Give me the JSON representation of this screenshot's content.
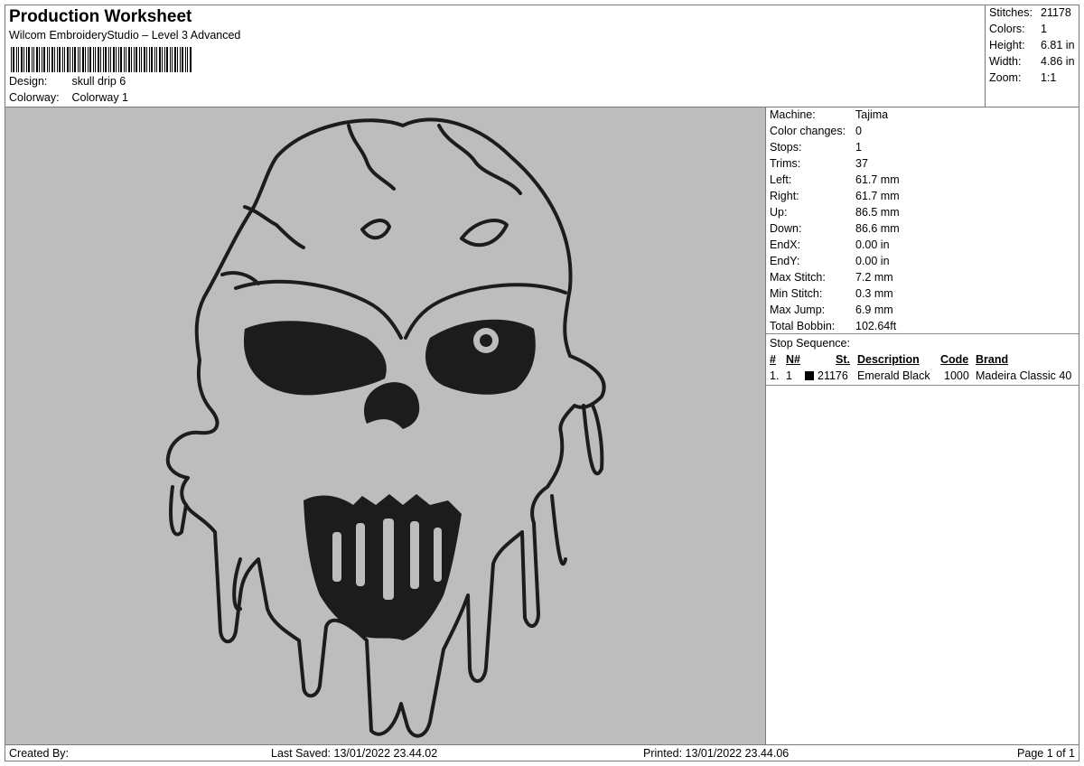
{
  "header": {
    "title": "Production Worksheet",
    "subtitle": "Wilcom EmbroideryStudio – Level 3 Advanced",
    "design_label": "Design:",
    "design_value": "skull drip 6",
    "colorway_label": "Colorway:",
    "colorway_value": "Colorway 1"
  },
  "summary": {
    "stitches_label": "Stitches:",
    "stitches_value": "21178",
    "colors_label": "Colors:",
    "colors_value": "1",
    "height_label": "Height:",
    "height_value": "6.81 in",
    "width_label": "Width:",
    "width_value": "4.86 in",
    "zoom_label": "Zoom:",
    "zoom_value": "1:1"
  },
  "machine_info": [
    {
      "label": "Machine:",
      "value": "Tajima"
    },
    {
      "label": "Color changes:",
      "value": "0"
    },
    {
      "label": "Stops:",
      "value": "1"
    },
    {
      "label": "Trims:",
      "value": "37"
    },
    {
      "label": "Left:",
      "value": "61.7 mm"
    },
    {
      "label": "Right:",
      "value": "61.7 mm"
    },
    {
      "label": "Up:",
      "value": "86.5 mm"
    },
    {
      "label": "Down:",
      "value": "86.6 mm"
    },
    {
      "label": "EndX:",
      "value": "0.00 in"
    },
    {
      "label": "EndY:",
      "value": "0.00 in"
    },
    {
      "label": "Max Stitch:",
      "value": "7.2 mm"
    },
    {
      "label": "Min Stitch:",
      "value": "0.3 mm"
    },
    {
      "label": "Max Jump:",
      "value": "6.9 mm"
    },
    {
      "label": "Total Bobbin:",
      "value": "102.64ft"
    }
  ],
  "stop_sequence": {
    "label": "Stop Sequence:",
    "columns": {
      "index": "#",
      "needle": "N#",
      "stitches": "St.",
      "description": "Description",
      "code": "Code",
      "brand": "Brand"
    },
    "rows": [
      {
        "index": "1.",
        "needle": "1",
        "color": "#000000",
        "stitches": "21176",
        "description": "Emerald Black",
        "code": "1000",
        "brand": "Madeira Classic 40"
      }
    ]
  },
  "footer": {
    "created_by": "Created By:",
    "last_saved": "Last Saved: 13/01/2022 23.44.02",
    "printed": "Printed: 13/01/2022 23.44.06",
    "page": "Page 1 of 1"
  },
  "colors": {
    "preview_background": "#bdbdbd",
    "thread": "#1c1c1c"
  }
}
